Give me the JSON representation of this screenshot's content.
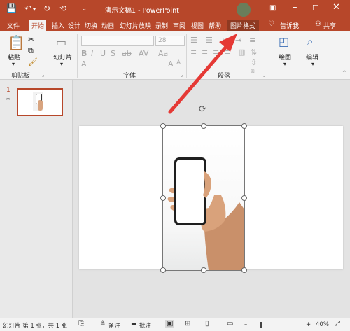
{
  "titlebar": {
    "title": "演示文稿1 - PowerPoint"
  },
  "tabs": {
    "file": "文件",
    "home": "开始",
    "insert": "插入",
    "design": "设计",
    "transitions": "切换",
    "animations": "动画",
    "slideshow": "幻灯片放映",
    "record": "录制",
    "review": "审阅",
    "view": "视图",
    "help": "帮助",
    "picture_format": "图片格式",
    "tell_me": "告诉我",
    "share": "共享"
  },
  "ribbon": {
    "paste": "粘贴",
    "clipboard": "剪贴板",
    "slides_button": "幻灯片",
    "font_group": "字体",
    "font_size": "28",
    "paragraph_group": "段落",
    "drawing": "绘图",
    "editing": "编辑"
  },
  "slides_pane": {
    "number": "1",
    "star": "*"
  },
  "status": {
    "slide_info": "幻灯片 第 1 张，共 1 张",
    "notes": "备注",
    "comments": "批注",
    "zoom": "40%"
  },
  "colors": {
    "accent": "#b7472a",
    "arrow": "#e53935"
  }
}
